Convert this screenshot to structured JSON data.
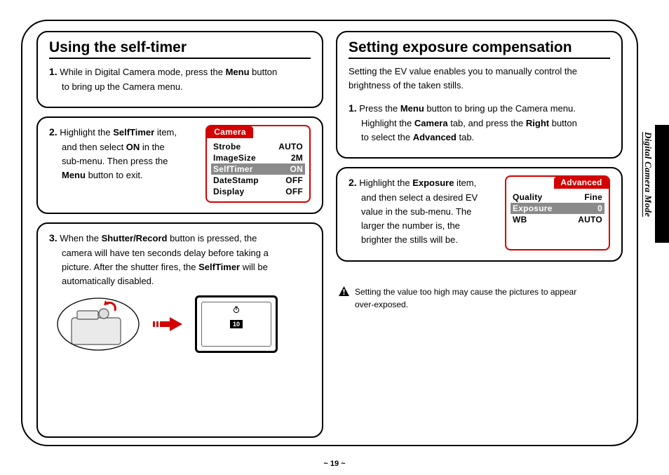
{
  "page_number": "~ 19 ~",
  "side_label": "Digital Camera Mode",
  "left": {
    "heading": "Using the self-timer",
    "step1_num": "1.",
    "step1_a": " While in Digital Camera mode, press the ",
    "step1_b": "Menu",
    "step1_c": " button",
    "step1_d": "to bring up the Camera menu.",
    "step2_num": "2.",
    "step2_a": " Highlight the ",
    "step2_b": "SelfTimer",
    "step2_c": " item,",
    "step2_d": "and then select ",
    "step2_e": "ON",
    "step2_f": " in the",
    "step2_g": "sub-menu. Then press the",
    "step2_h": "Menu",
    "step2_i": " button to exit.",
    "menu_tab": "Camera",
    "menu_rows": [
      {
        "label": "Strobe",
        "value": "AUTO",
        "sel": false
      },
      {
        "label": "ImageSize",
        "value": "2M",
        "sel": false
      },
      {
        "label": "SelfTimer",
        "value": "ON",
        "sel": true
      },
      {
        "label": "DateStamp",
        "value": "OFF",
        "sel": false
      },
      {
        "label": "Display",
        "value": "OFF",
        "sel": false
      }
    ],
    "step3_num": "3.",
    "step3_a": " When the ",
    "step3_b": "Shutter/Record",
    "step3_c": " button is pressed, the",
    "step3_d": "camera will have ten seconds delay before taking a",
    "step3_e": "picture. After the shutter fires, the ",
    "step3_f": "SelfTimer",
    "step3_g": " will be",
    "step3_h": "automatically disabled.",
    "screen_count": "10"
  },
  "right": {
    "heading": "Setting exposure compensation",
    "intro_a": "Setting the EV value enables you to manually control the",
    "intro_b": "brightness of the taken stills.",
    "step1_num": "1.",
    "step1_a": " Press the ",
    "step1_b": "Menu",
    "step1_c": " button to bring up the Camera menu.",
    "step1_d": "Highlight the ",
    "step1_e": "Camera",
    "step1_f": " tab, and press the ",
    "step1_g": "Right",
    "step1_h": " button",
    "step1_i": "to select the ",
    "step1_j": "Advanced",
    "step1_k": " tab.",
    "step2_num": "2.",
    "step2_a": " Highlight the ",
    "step2_b": "Exposure",
    "step2_c": " item,",
    "step2_d": "and then select a desired EV",
    "step2_e": "value in the sub-menu. The",
    "step2_f": "larger the number is, the",
    "step2_g": "brighter the stills will be.",
    "menu_tab": "Advanced",
    "menu_rows": [
      {
        "label": "Quality",
        "value": "Fine",
        "sel": false
      },
      {
        "label": "Exposure",
        "value": "0",
        "sel": true
      },
      {
        "label": "WB",
        "value": "AUTO",
        "sel": false
      }
    ],
    "warn_a": "Setting the value too high may cause the pictures to appear",
    "warn_b": "over-exposed."
  }
}
